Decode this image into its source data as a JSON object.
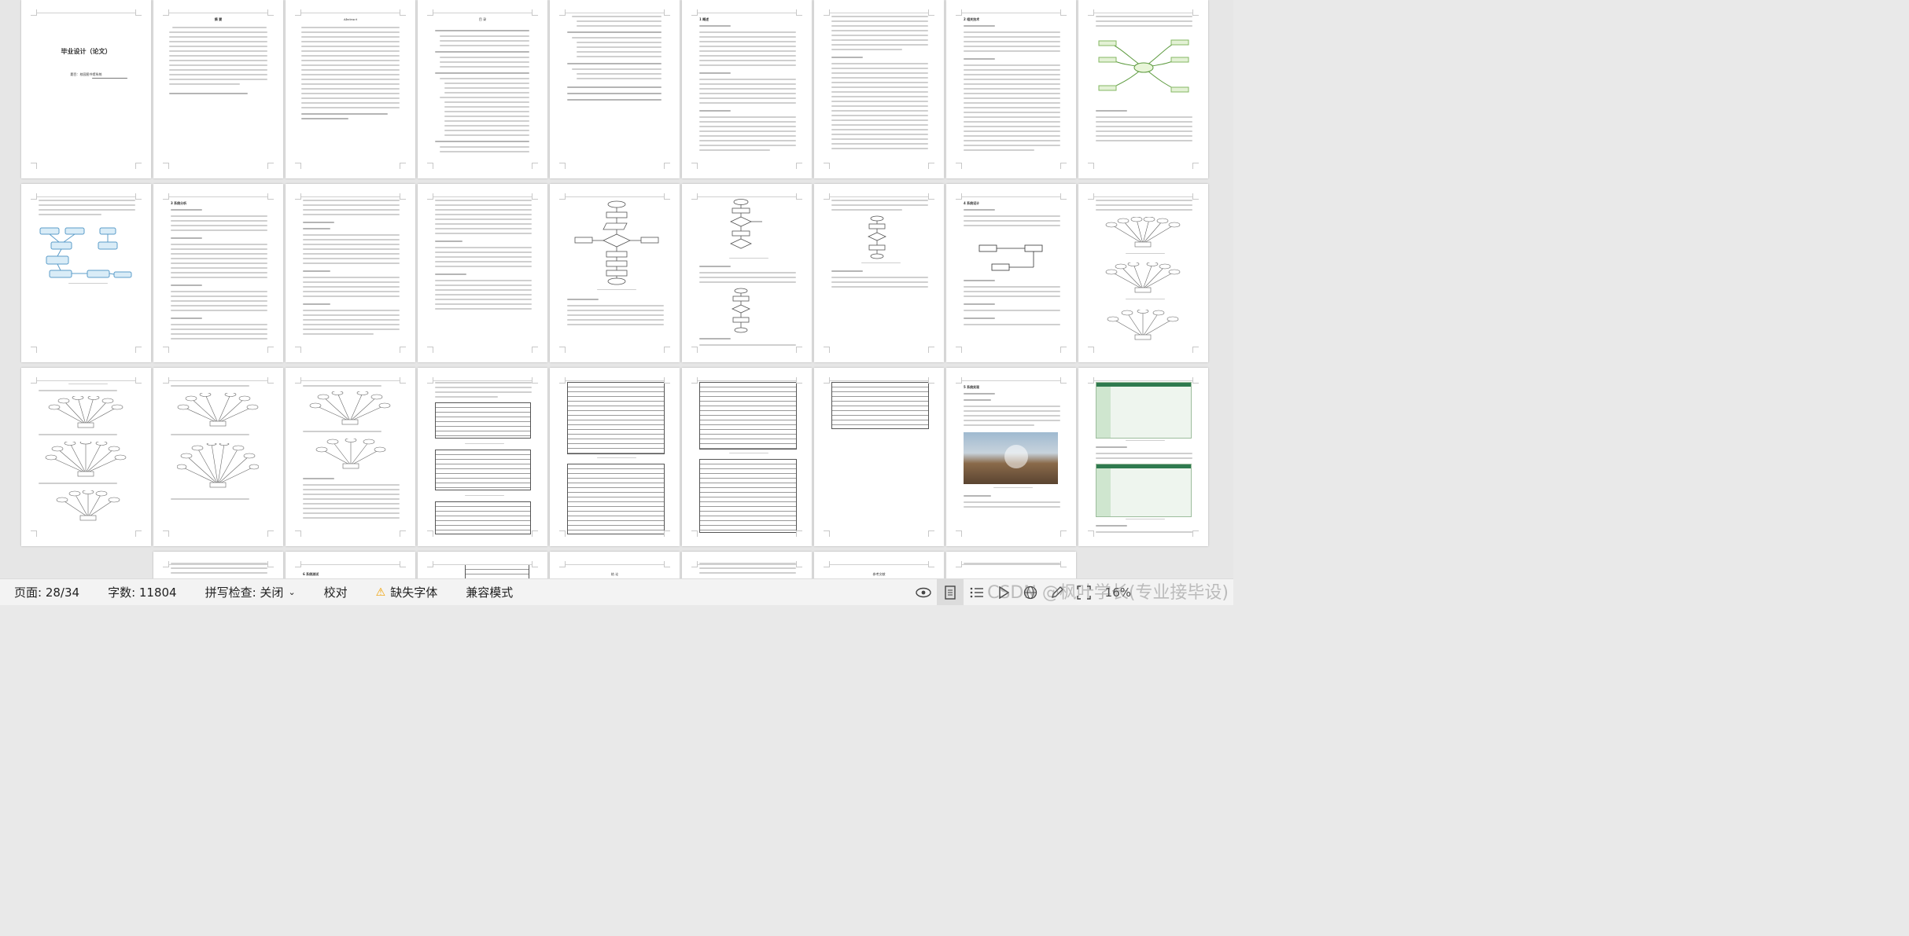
{
  "document": {
    "cover_title": "毕业设计（论文）",
    "cover_subtitle": "题目：校园图书馆系统",
    "abstract_cn_heading": "摘  要",
    "abstract_en_heading": "Abstract",
    "toc_heading": "目  录",
    "chapter1_heading": "1  概述",
    "chapter2_heading": "2  相关技术",
    "chapter3_heading": "3  系统分析",
    "chapter4_heading": "4  系统设计",
    "chapter5_heading": "5  系统实现",
    "chapter6_heading": "6  系统测试",
    "conclusion_heading": "结  论",
    "references_heading": "参考文献",
    "figure_caption_er": "图3-1 系统用例图"
  },
  "status_bar": {
    "page": "页面: 28/34",
    "word_count": "字数: 11804",
    "spell_check": "拼写检查: 关闭",
    "proofread": "校对",
    "missing_fonts": "缺失字体",
    "compat_mode": "兼容模式",
    "zoom": "16%"
  },
  "icons": {
    "eye": "eye-icon",
    "page_view": "page-view-icon",
    "outline": "outline-icon",
    "play": "play-icon",
    "web": "web-layout-icon",
    "pen": "pen-icon",
    "fit": "fit-page-icon"
  },
  "watermark": "CSDN @枫叶学长(专业接毕设)",
  "colors": {
    "warning": "#f0a000",
    "status_bg": "#f3f3f3",
    "canvas_bg": "#e6e6e6"
  }
}
